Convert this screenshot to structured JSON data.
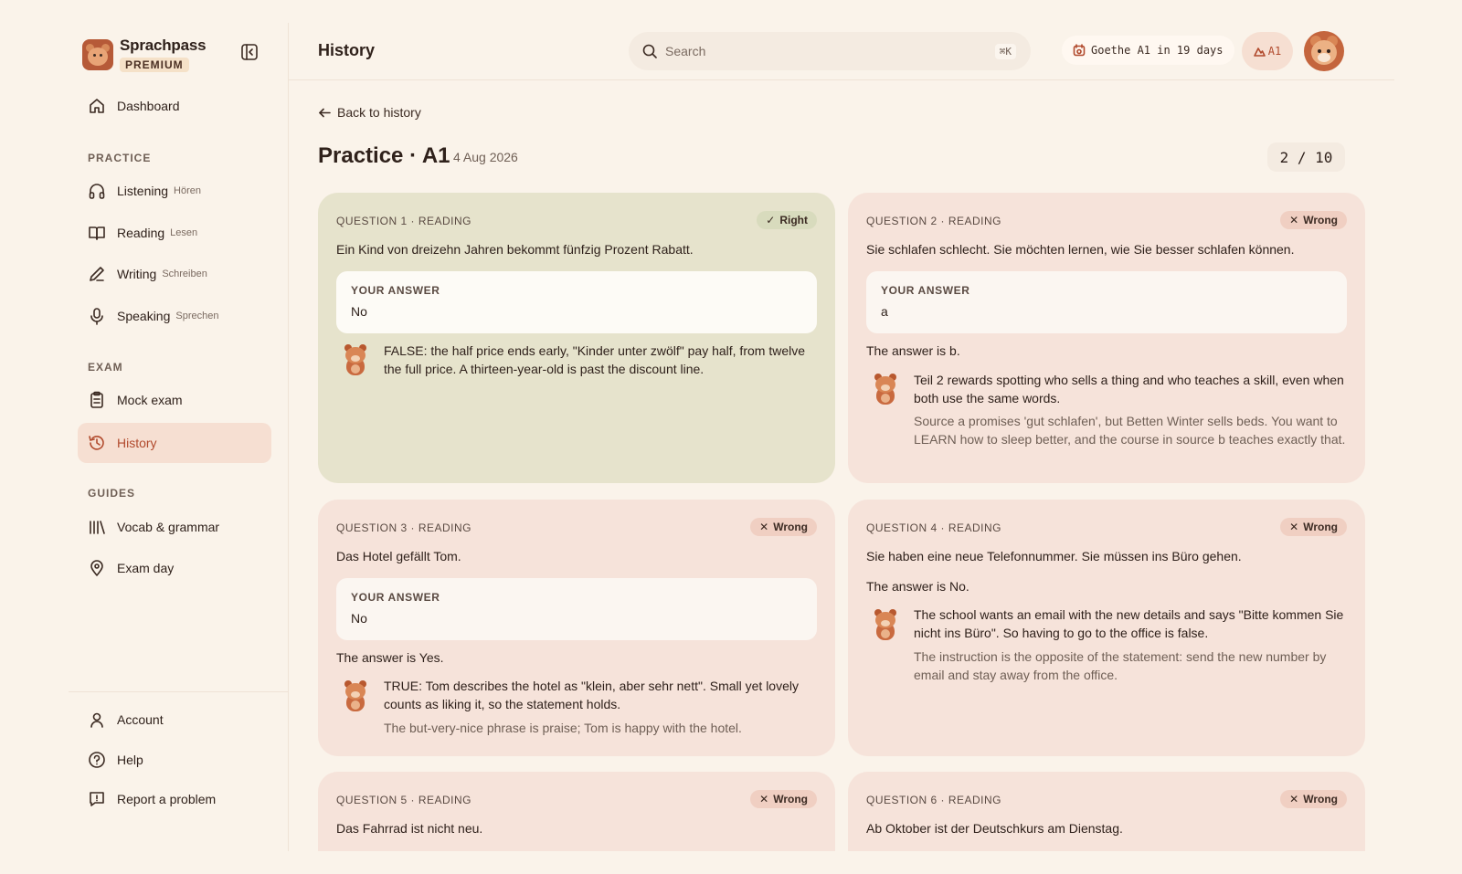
{
  "brand": {
    "name": "Sprachpass",
    "badge": "PREMIUM"
  },
  "nav": {
    "dashboard": "Dashboard",
    "practice_label": "PRACTICE",
    "listening": {
      "label": "Listening",
      "sub": "Hören"
    },
    "reading": {
      "label": "Reading",
      "sub": "Lesen"
    },
    "writing": {
      "label": "Writing",
      "sub": "Schreiben"
    },
    "speaking": {
      "label": "Speaking",
      "sub": "Sprechen"
    },
    "exam_label": "EXAM",
    "mock_exam": "Mock exam",
    "history": "History",
    "guides_label": "GUIDES",
    "vocab": "Vocab & grammar",
    "exam_day": "Exam day",
    "account": "Account",
    "help": "Help",
    "report": "Report a problem"
  },
  "header": {
    "title": "History",
    "search_placeholder": "Search",
    "search_shortcut": "⌘K",
    "exam_countdown": "Goethe A1 in 19 days",
    "level": "A1"
  },
  "page": {
    "back": "Back to history",
    "title": "Practice · A1",
    "date": "4 Aug 2026",
    "counter": "2 / 10"
  },
  "labels": {
    "your_answer": "YOUR ANSWER"
  },
  "questions": [
    {
      "head": "QUESTION 1 · READING",
      "status": "Right",
      "text": "Ein Kind von dreizehn Jahren bekommt fünfzig Prozent Rabatt.",
      "your_answer": "No",
      "explanation": "FALSE: the half price ends early, \"Kinder unter zwölf\" pay half, from twelve the full price. A thirteen-year-old is past the discount line."
    },
    {
      "head": "QUESTION 2 · READING",
      "status": "Wrong",
      "text": "Sie schlafen schlecht. Sie möchten lernen, wie Sie besser schlafen können.",
      "your_answer": "a",
      "correct": "The answer is b.",
      "explanation": "Teil 2 rewards spotting who sells a thing and who teaches a skill, even when both use the same words.",
      "detail": "Source a promises 'gut schlafen', but Betten Winter sells beds. You want to LEARN how to sleep better, and the course in source b teaches exactly that."
    },
    {
      "head": "QUESTION 3 · READING",
      "status": "Wrong",
      "text": "Das Hotel gefällt Tom.",
      "your_answer": "No",
      "correct": "The answer is Yes.",
      "explanation": "TRUE: Tom describes the hotel as \"klein, aber sehr nett\". Small yet lovely counts as liking it, so the statement holds.",
      "detail": "The but-very-nice phrase is praise; Tom is happy with the hotel."
    },
    {
      "head": "QUESTION 4 · READING",
      "status": "Wrong",
      "text": "Sie haben eine neue Telefonnummer. Sie müssen ins Büro gehen.",
      "correct": "The answer is No.",
      "explanation": "The school wants an email with the new details and says \"Bitte kommen Sie nicht ins Büro\". So having to go to the office is false.",
      "detail": "The instruction is the opposite of the statement: send the new number by email and stay away from the office."
    },
    {
      "head": "QUESTION 5 · READING",
      "status": "Wrong",
      "text": "Das Fahrrad ist nicht neu."
    },
    {
      "head": "QUESTION 6 · READING",
      "status": "Wrong",
      "text": "Ab Oktober ist der Deutschkurs am Dienstag."
    }
  ],
  "colors": {
    "accent": "#b14a2d",
    "right_card": "#e6e3cc",
    "wrong_card": "#f6e3da",
    "background": "#faf3ea"
  }
}
